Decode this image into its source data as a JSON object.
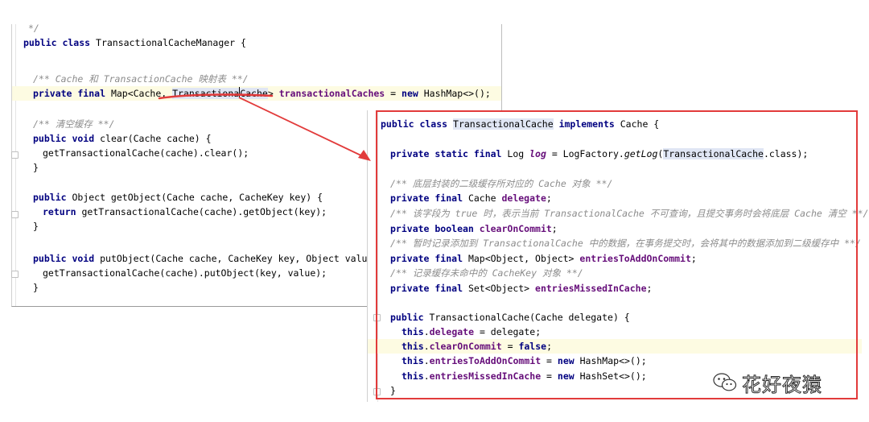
{
  "left_editor": {
    "lines": [
      {
        "seg": [
          {
            "t": "*/",
            "c": "cm"
          }
        ]
      },
      {
        "seg": [
          {
            "t": "public class ",
            "c": "kw"
          },
          {
            "t": "TransactionalCacheManager {"
          }
        ]
      },
      {
        "seg": []
      },
      {
        "seg": [
          {
            "t": "/** ",
            "c": "cm"
          },
          {
            "t": "Cache",
            "c": "cm"
          },
          {
            "t": " 和 ",
            "c": "cm"
          },
          {
            "t": "TransactionCache",
            "c": "cm"
          },
          {
            "t": " 映射表 **/",
            "c": "cm"
          }
        ]
      },
      {
        "seg": [
          {
            "t": "private final ",
            "c": "kw"
          },
          {
            "t": "Map<Cache, "
          },
          {
            "t": "Transactiona",
            "c": "sel"
          },
          {
            "t": "Cache",
            "c": "sel"
          },
          {
            "t": "> "
          },
          {
            "t": "transactionalCaches",
            "c": "fd"
          },
          {
            "t": " = "
          },
          {
            "t": "new ",
            "c": "kw"
          },
          {
            "t": "HashMap<>();"
          }
        ]
      },
      {
        "seg": []
      },
      {
        "seg": [
          {
            "t": "/** ",
            "c": "cm"
          },
          {
            "t": "清空缓存",
            "c": "cm"
          },
          {
            "t": " **/",
            "c": "cm"
          }
        ]
      },
      {
        "seg": [
          {
            "t": "public void ",
            "c": "kw"
          },
          {
            "t": "clear(Cache cache) {"
          }
        ]
      },
      {
        "seg": [
          {
            "t": "getTransactionalCache(cache).clear();"
          }
        ]
      },
      {
        "seg": [
          {
            "t": "}"
          }
        ]
      },
      {
        "seg": []
      },
      {
        "seg": [
          {
            "t": "public ",
            "c": "kw"
          },
          {
            "t": "Object getObject(Cache cache, CacheKey key) {"
          }
        ]
      },
      {
        "seg": [
          {
            "t": "return ",
            "c": "kw"
          },
          {
            "t": "getTransactionalCache(cache).getObject(key);"
          }
        ]
      },
      {
        "seg": [
          {
            "t": "}"
          }
        ]
      },
      {
        "seg": []
      },
      {
        "seg": [
          {
            "t": "public void ",
            "c": "kw"
          },
          {
            "t": "putObject(Cache cache, CacheKey key, Object value) {"
          }
        ]
      },
      {
        "seg": [
          {
            "t": "getTransactionalCache(cache).putObject(key, value);"
          }
        ]
      },
      {
        "seg": [
          {
            "t": "}"
          }
        ]
      }
    ]
  },
  "right_editor": {
    "lines": [
      {
        "seg": [
          {
            "t": "public class ",
            "c": "kw"
          },
          {
            "t": "TransactionalCache",
            "c": "sel"
          },
          {
            "t": " "
          },
          {
            "t": "implements ",
            "c": "kw"
          },
          {
            "t": "Cache {"
          }
        ]
      },
      {
        "seg": []
      },
      {
        "seg": [
          {
            "t": "private static final ",
            "c": "kw"
          },
          {
            "t": "Log "
          },
          {
            "t": "log",
            "c": "fd it"
          },
          {
            "t": " = LogFactory."
          },
          {
            "t": "getLog",
            "c": "it"
          },
          {
            "t": "("
          },
          {
            "t": "TransactionalCache",
            "c": "sel"
          },
          {
            "t": ".class);"
          }
        ]
      },
      {
        "seg": []
      },
      {
        "seg": [
          {
            "t": "/** 底层封装的二级缓存所对应的 ",
            "c": "cm"
          },
          {
            "t": "Cache",
            "c": "cm"
          },
          {
            "t": " 对象 **/",
            "c": "cm"
          }
        ]
      },
      {
        "seg": [
          {
            "t": "private final ",
            "c": "kw"
          },
          {
            "t": "Cache "
          },
          {
            "t": "delegate",
            "c": "fd"
          },
          {
            "t": ";"
          }
        ]
      },
      {
        "seg": [
          {
            "t": "/** 该字段为 ",
            "c": "cm"
          },
          {
            "t": "true",
            "c": "cm"
          },
          {
            "t": " 时，表示当前 ",
            "c": "cm"
          },
          {
            "t": "TransactionalCache",
            "c": "cm"
          },
          {
            "t": " 不可查询，且提交事务时会将底层 ",
            "c": "cm"
          },
          {
            "t": "Cache",
            "c": "cm"
          },
          {
            "t": " 清空 **/",
            "c": "cm"
          }
        ]
      },
      {
        "seg": [
          {
            "t": "private boolean ",
            "c": "kw"
          },
          {
            "t": "clearOnCommit",
            "c": "fd"
          },
          {
            "t": ";"
          }
        ]
      },
      {
        "seg": [
          {
            "t": "/** 暂时记录添加到 ",
            "c": "cm"
          },
          {
            "t": "TransactionalCache",
            "c": "cm"
          },
          {
            "t": " 中的数据，在事务提交时，会将其中的数据添加到二级缓存中 **/",
            "c": "cm"
          }
        ]
      },
      {
        "seg": [
          {
            "t": "private final ",
            "c": "kw"
          },
          {
            "t": "Map<Object, Object> "
          },
          {
            "t": "entriesToAddOnCommit",
            "c": "fd"
          },
          {
            "t": ";"
          }
        ]
      },
      {
        "seg": [
          {
            "t": "/** 记录缓存未命中的 ",
            "c": "cm"
          },
          {
            "t": "CacheKey",
            "c": "cm"
          },
          {
            "t": " 对象 **/",
            "c": "cm"
          }
        ]
      },
      {
        "seg": [
          {
            "t": "private final ",
            "c": "kw"
          },
          {
            "t": "Set<Object> "
          },
          {
            "t": "entriesMissedInCache",
            "c": "fd"
          },
          {
            "t": ";"
          }
        ]
      },
      {
        "seg": []
      },
      {
        "seg": [
          {
            "t": "public ",
            "c": "kw"
          },
          {
            "t": "TransactionalCache(Cache delegate) {"
          }
        ]
      },
      {
        "seg": [
          {
            "t": "this",
            "c": "kw"
          },
          {
            "t": "."
          },
          {
            "t": "delegate",
            "c": "fd"
          },
          {
            "t": " = delegate;"
          }
        ]
      },
      {
        "seg": [
          {
            "t": "this",
            "c": "kw"
          },
          {
            "t": "."
          },
          {
            "t": "clearOnCommit",
            "c": "fd"
          },
          {
            "t": " = "
          },
          {
            "t": "false",
            "c": "kw"
          },
          {
            "t": ";"
          }
        ]
      },
      {
        "seg": [
          {
            "t": "this",
            "c": "kw"
          },
          {
            "t": "."
          },
          {
            "t": "entriesToAddOnCommit",
            "c": "fd"
          },
          {
            "t": " = "
          },
          {
            "t": "new ",
            "c": "kw"
          },
          {
            "t": "HashMap<>();"
          }
        ]
      },
      {
        "seg": [
          {
            "t": "this",
            "c": "kw"
          },
          {
            "t": "."
          },
          {
            "t": "entriesMissedInCache",
            "c": "fd"
          },
          {
            "t": " = "
          },
          {
            "t": "new ",
            "c": "kw"
          },
          {
            "t": "HashSet<>();"
          }
        ]
      },
      {
        "seg": [
          {
            "t": "}"
          }
        ]
      }
    ]
  },
  "watermark": {
    "icon": "wechat-icon",
    "text": "花好夜猿"
  },
  "colors": {
    "annotation_red": "#e23b3b",
    "keyword": "#000080",
    "field": "#660e7a",
    "comment": "#8c8c8c",
    "selection": "#e0e6f4",
    "current_line": "#fdfbe2"
  }
}
